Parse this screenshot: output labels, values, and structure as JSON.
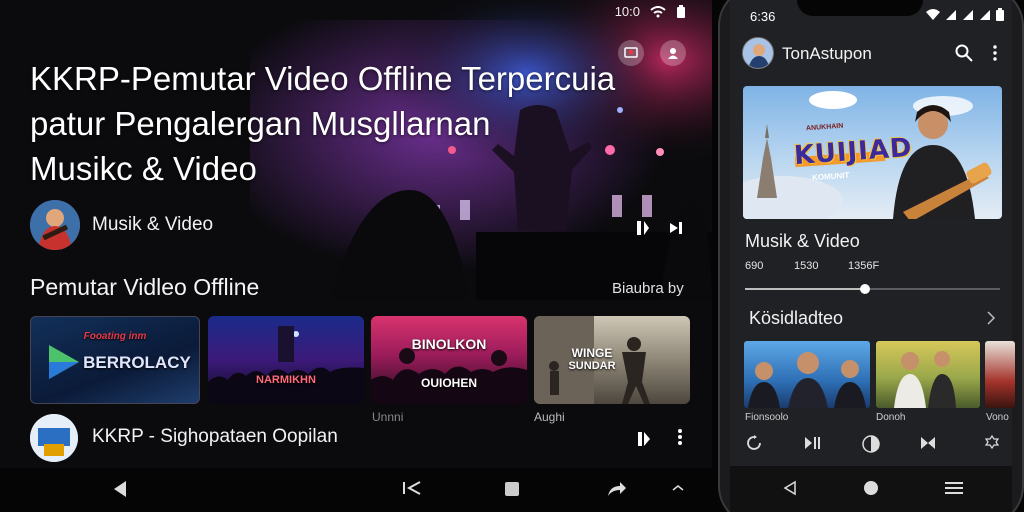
{
  "left_screen": {
    "status": {
      "time": "10:0",
      "wifi_icon": "wifi-icon",
      "battery_icon": "battery-icon"
    },
    "header_buttons": [
      "cast-icon",
      "profile-icon"
    ],
    "hero": {
      "title_lines": [
        "KKRP-Pemutar Video Offline Terpercuia",
        "patur Pengalergan Musgllarnan",
        "Musikc & Video"
      ],
      "channel_name": "Musik & Video"
    },
    "section": {
      "title": "Pemutar Vidleo  Offline",
      "meta": "Biaubra by"
    },
    "thumbnails": [
      {
        "label": "BERROLACY",
        "sub": "Fooating inm",
        "caption": ""
      },
      {
        "label": "NARMIKHN",
        "sub": "",
        "caption": ""
      },
      {
        "label": "OUIOHEN",
        "sub": "BINOLKON",
        "caption": "Unnni"
      },
      {
        "label": "WINGE",
        "sub": "SUNDAR",
        "caption": "Aughi"
      }
    ],
    "now_playing_row": {
      "title": "KKRP -  Sighopataen Oopilan"
    },
    "nav_icons": [
      "back-icon",
      "skip-back-icon",
      "stop-icon",
      "share-icon",
      "expand-icon"
    ]
  },
  "phone": {
    "time": "6:36",
    "app_title": "TonAstupon",
    "banner": {
      "title": "KUIJIAD",
      "tagline": "ANUKHAIN",
      "subline": "KOMUNIT"
    },
    "section_title": "Musik & Video",
    "stats": [
      "690",
      "1530",
      "1356F"
    ],
    "progress_fraction": 0.47,
    "section2_title": "Kösidladteo",
    "thumb_captions": [
      "Fionsoolo",
      "Donoh",
      "Vono"
    ],
    "player_icons": [
      "repeat-icon",
      "play-pause-icon",
      "volume-icon",
      "skip-icon",
      "settings-icon"
    ],
    "nav_icons": [
      "back-icon",
      "home-icon",
      "menu-icon"
    ]
  }
}
